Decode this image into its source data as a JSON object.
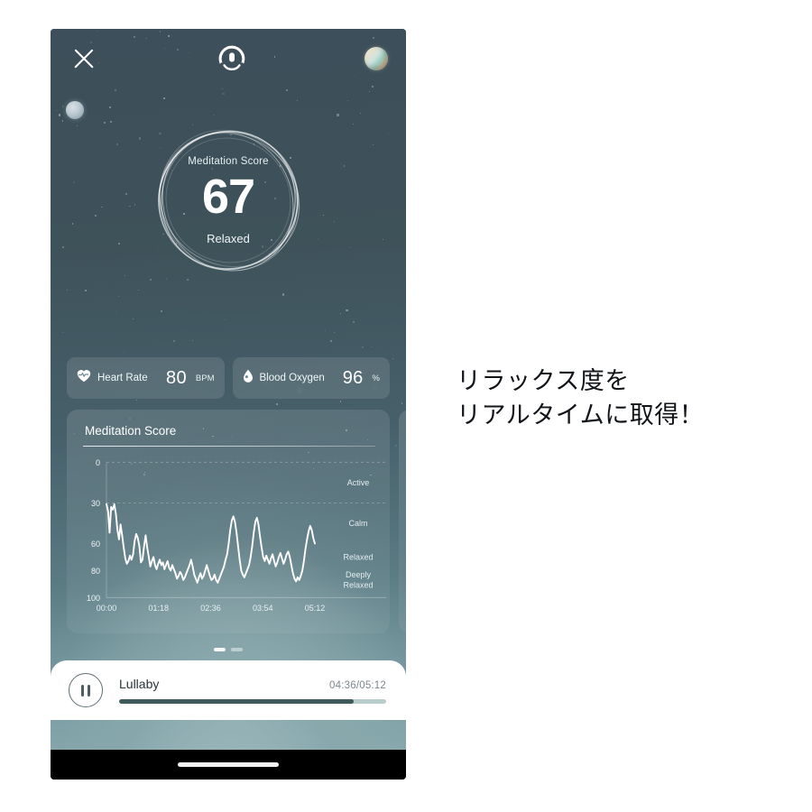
{
  "app": {
    "header": {
      "close_icon": "close-icon",
      "brand_icon": "headband-device-icon",
      "profile_icon": "planet-avatar-icon",
      "moon_decoration_icon": "moon-icon"
    },
    "score": {
      "label": "Meditation Score",
      "value": "67",
      "state": "Relaxed"
    },
    "vitals": [
      {
        "icon": "heart-pulse-icon",
        "name": "Heart Rate",
        "value": "80",
        "unit": "BPM"
      },
      {
        "icon": "blood-drop-icon",
        "name": "Blood Oxygen",
        "value": "96",
        "unit": "%"
      }
    ],
    "card": {
      "title": "Meditation Score"
    },
    "pager": {
      "dots": 2,
      "active": 0
    },
    "player": {
      "play_icon": "pause-icon",
      "track": "Lullaby",
      "time": "04:36/05:12",
      "progress_percent": 88
    }
  },
  "caption": {
    "text": "リラックス度を\nリアルタイムに取得！"
  },
  "colors": {
    "accent": "#3f5b5c",
    "track_bg": "#b9cdcd",
    "card_text": "#ffffff",
    "screen_top": "#3c4e59",
    "screen_bottom": "#93b2b4"
  },
  "chart_data": {
    "type": "line",
    "title": "Meditation Score",
    "xlabel": "",
    "ylabel": "",
    "grid": true,
    "legend_position": "right",
    "ylim": [
      0,
      100
    ],
    "y_inverted": true,
    "yticks": [
      0,
      30,
      60,
      80,
      100
    ],
    "ytick_labels": [
      "0",
      "30",
      "60",
      "80",
      "100"
    ],
    "xticks": [
      0,
      78,
      156,
      234,
      312
    ],
    "xtick_labels": [
      "00:00",
      "01:18",
      "02:36",
      "03:54",
      "05:12"
    ],
    "zone_labels": [
      {
        "label": "Active",
        "y": 15
      },
      {
        "label": "Calm",
        "y": 45
      },
      {
        "label": "Relaxed",
        "y": 70
      },
      {
        "label": "Deeply Relaxed",
        "y": 88
      }
    ],
    "gridlines_y": [
      0,
      30
    ],
    "series": [
      {
        "name": "Meditation Score",
        "color": "#ffffff",
        "values": [
          31,
          36,
          52,
          33,
          35,
          31,
          38,
          50,
          57,
          46,
          54,
          63,
          71,
          75,
          73,
          69,
          72,
          68,
          58,
          53,
          56,
          62,
          74,
          72,
          62,
          54,
          63,
          70,
          77,
          73,
          70,
          76,
          79,
          75,
          72,
          76,
          74,
          79,
          76,
          73,
          78,
          80,
          76,
          79,
          82,
          86,
          84,
          81,
          83,
          87,
          85,
          82,
          79,
          76,
          72,
          77,
          83,
          86,
          89,
          85,
          82,
          86,
          84,
          80,
          76,
          80,
          84,
          87,
          86,
          83,
          87,
          89,
          86,
          83,
          80,
          77,
          72,
          68,
          60,
          50,
          43,
          40,
          44,
          52,
          62,
          72,
          80,
          83,
          85,
          82,
          79,
          76,
          70,
          62,
          52,
          44,
          41,
          46,
          55,
          63,
          70,
          73,
          69,
          72,
          75,
          71,
          68,
          73,
          77,
          74,
          70,
          67,
          71,
          75,
          72,
          68,
          66,
          70,
          76,
          82,
          86,
          88,
          85,
          87,
          84,
          80,
          73,
          64,
          57,
          51,
          47,
          50,
          56,
          60
        ]
      }
    ]
  }
}
